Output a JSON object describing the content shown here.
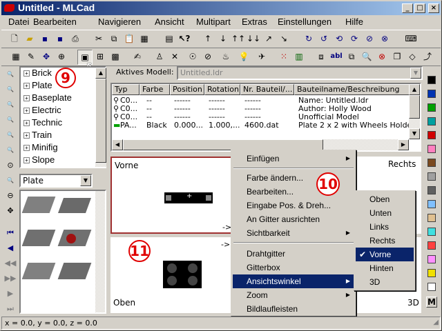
{
  "window": {
    "title": "Untitled - MLCad"
  },
  "menubar": [
    "Datei",
    "Bearbeiten",
    "Navigieren",
    "Ansicht",
    "Multipart",
    "Extras",
    "Einstellungen",
    "Hilfe"
  ],
  "tree": {
    "items": [
      "Brick",
      "Plate",
      "Baseplate",
      "Electric",
      "Technic",
      "Train",
      "Minifig",
      "Slope"
    ]
  },
  "parts_filter": {
    "selected": "Plate"
  },
  "model": {
    "label": "Aktives Modell:",
    "value": "Untitled.ldr"
  },
  "table": {
    "headers": [
      "Typ",
      "Farbe",
      "Position",
      "Rotation",
      "Nr. Bauteil/...",
      "Bauteilname/Beschreibung"
    ],
    "rows": [
      [
        "C0...",
        "--",
        "------",
        "------",
        "------",
        "Name: Untitled.ldr"
      ],
      [
        "C0...",
        "--",
        "------",
        "------",
        "------",
        "Author: Holly Wood"
      ],
      [
        "C0...",
        "--",
        "------",
        "------",
        "------",
        "Unofficial Model"
      ],
      [
        "PA...",
        "Black",
        "0.000...",
        "1.000,...",
        "4600.dat",
        "Plate  2 x  2 with Wheels Holder"
      ]
    ]
  },
  "views": {
    "front": "Vorne",
    "right": "Rechts",
    "top": "Oben",
    "three_d": "3D"
  },
  "context_menu": {
    "items": [
      "Einfügen",
      "Farbe ändern...",
      "Bearbeiten...",
      "Eingabe Pos. & Dreh...",
      "An Gitter ausrichten",
      "Sichtbarkeit",
      "Drahtgitter",
      "Gitterbox",
      "Ansichtswinkel",
      "Zoom",
      "Bildlaufleisten"
    ],
    "highlighted": "Ansichtswinkel"
  },
  "submenu": {
    "items": [
      "Oben",
      "Unten",
      "Links",
      "Rechts",
      "Vorne",
      "Hinten",
      "3D"
    ],
    "checked": "Vorne"
  },
  "markers": [
    "9",
    "10",
    "11"
  ],
  "statusbar": {
    "coords": "x = 0.0, y = 0.0, z = 0.0"
  },
  "palette_label": "M",
  "colors": {
    "title_start": "#0a246a",
    "title_end": "#a6caf0",
    "highlight": "#0a246a",
    "marker": "#e00000"
  }
}
